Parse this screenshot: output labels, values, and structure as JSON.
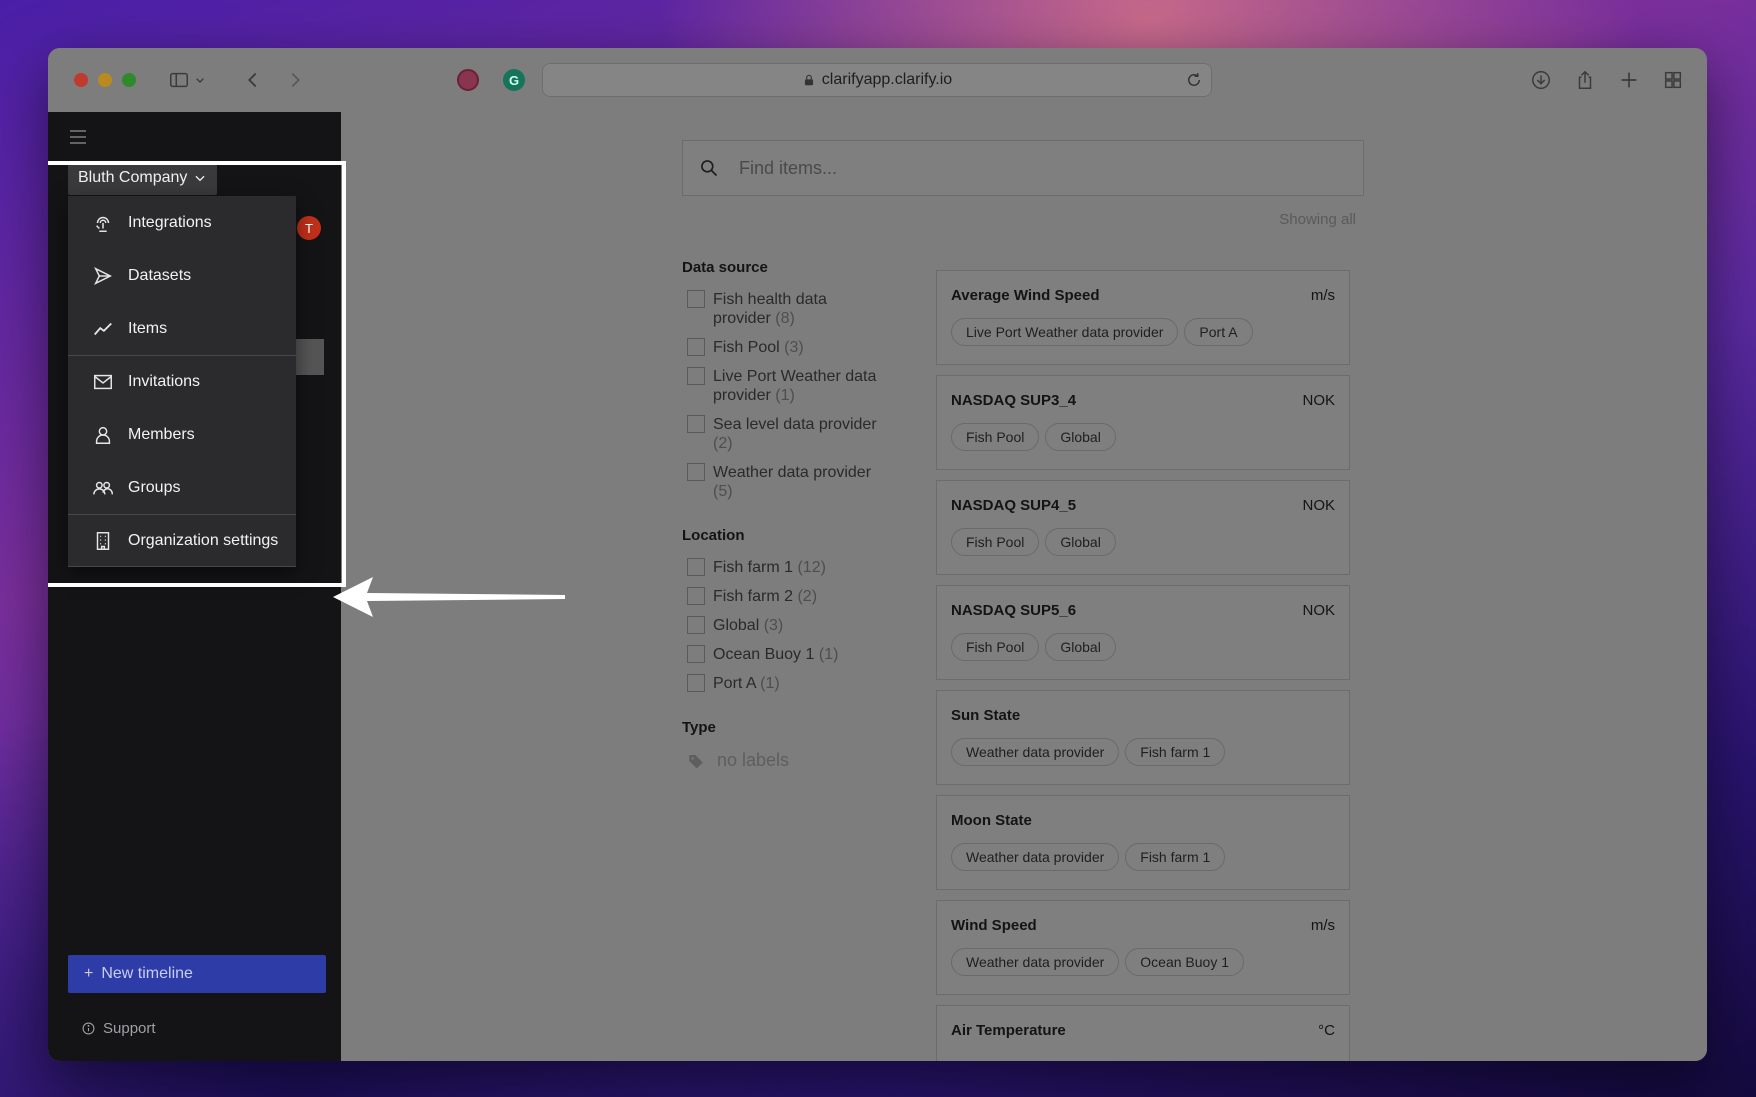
{
  "browser": {
    "url": "clarifyapp.clarify.io"
  },
  "sidebar": {
    "org_name": "Bluth Company",
    "avatar_letter": "T",
    "menu": [
      {
        "label": "Integrations",
        "icon": "integrations-icon"
      },
      {
        "label": "Datasets",
        "icon": "send-icon"
      },
      {
        "label": "Items",
        "icon": "line-chart-icon"
      },
      {
        "label": "Invitations",
        "icon": "mail-icon"
      },
      {
        "label": "Members",
        "icon": "person-icon"
      },
      {
        "label": "Groups",
        "icon": "group-icon"
      },
      {
        "label": "Organization settings",
        "icon": "building-icon"
      }
    ],
    "new_timeline": "New timeline",
    "support": "Support"
  },
  "main": {
    "search_placeholder": "Find items...",
    "showing": "Showing all",
    "filters": {
      "data_source": {
        "title": "Data source",
        "options": [
          {
            "label": "Fish health data provider",
            "count": "(8)"
          },
          {
            "label": "Fish Pool",
            "count": "(3)"
          },
          {
            "label": "Live Port Weather data provider",
            "count": "(1)"
          },
          {
            "label": "Sea level data provider",
            "count": "(2)"
          },
          {
            "label": "Weather data provider",
            "count": "(5)"
          }
        ]
      },
      "location": {
        "title": "Location",
        "options": [
          {
            "label": "Fish farm 1",
            "count": "(12)"
          },
          {
            "label": "Fish farm 2",
            "count": "(2)"
          },
          {
            "label": "Global",
            "count": "(3)"
          },
          {
            "label": "Ocean Buoy 1",
            "count": "(1)"
          },
          {
            "label": "Port A",
            "count": "(1)"
          }
        ]
      },
      "type": {
        "title": "Type",
        "empty": "no labels"
      }
    },
    "items": [
      {
        "title": "Average Wind Speed",
        "unit": "m/s",
        "tags": [
          "Live Port Weather data provider",
          "Port A"
        ]
      },
      {
        "title": "NASDAQ SUP3_4",
        "unit": "NOK",
        "tags": [
          "Fish Pool",
          "Global"
        ]
      },
      {
        "title": "NASDAQ SUP4_5",
        "unit": "NOK",
        "tags": [
          "Fish Pool",
          "Global"
        ]
      },
      {
        "title": "NASDAQ SUP5_6",
        "unit": "NOK",
        "tags": [
          "Fish Pool",
          "Global"
        ]
      },
      {
        "title": "Sun State",
        "unit": "",
        "tags": [
          "Weather data provider",
          "Fish farm 1"
        ]
      },
      {
        "title": "Moon State",
        "unit": "",
        "tags": [
          "Weather data provider",
          "Fish farm 1"
        ]
      },
      {
        "title": "Wind Speed",
        "unit": "m/s",
        "tags": [
          "Weather data provider",
          "Ocean Buoy 1"
        ]
      },
      {
        "title": "Air Temperature",
        "unit": "°C",
        "tags": []
      }
    ]
  }
}
